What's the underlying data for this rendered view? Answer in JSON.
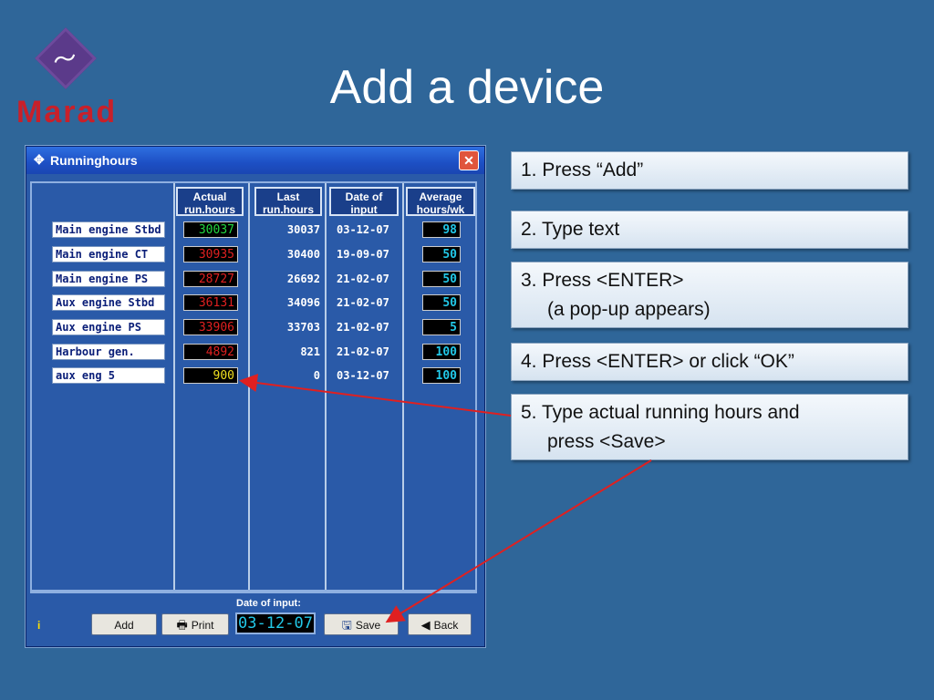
{
  "slide": {
    "title": "Add a device"
  },
  "logo": {
    "text": "Marad"
  },
  "window": {
    "title": "Runninghours",
    "close_label": "✕",
    "columns": {
      "actual": [
        "Actual",
        "run.hours"
      ],
      "last": [
        "Last",
        "run.hours"
      ],
      "date": [
        "Date of",
        "input"
      ],
      "average": [
        "Average",
        "hours/wk"
      ]
    },
    "rows": [
      {
        "name": "Main engine Stbd",
        "actual": "30037",
        "actual_color": "#22d840",
        "last": "30037",
        "date": "03-12-07",
        "avg": "98"
      },
      {
        "name": "Main engine CT",
        "actual": "30935",
        "actual_color": "#e02020",
        "last": "30400",
        "date": "19-09-07",
        "avg": "50"
      },
      {
        "name": "Main engine PS",
        "actual": "28727",
        "actual_color": "#e02020",
        "last": "26692",
        "date": "21-02-07",
        "avg": "50"
      },
      {
        "name": "Aux engine Stbd",
        "actual": "36131",
        "actual_color": "#e02020",
        "last": "34096",
        "date": "21-02-07",
        "avg": "50"
      },
      {
        "name": "Aux engine PS",
        "actual": "33906",
        "actual_color": "#e02020",
        "last": "33703",
        "date": "21-02-07",
        "avg": "5"
      },
      {
        "name": "Harbour gen.",
        "actual": "4892",
        "actual_color": "#e02020",
        "last": "821",
        "date": "21-02-07",
        "avg": "100"
      },
      {
        "name": "aux eng 5",
        "actual": "900",
        "actual_color": "#f0e020",
        "last": "0",
        "date": "03-12-07",
        "avg": "100"
      }
    ],
    "footer": {
      "info": "i",
      "date_of_input_label": "Date of input:",
      "date_of_input_value": "03-12-07",
      "add_label": "Add",
      "print_label": "Print",
      "save_label": "Save",
      "back_label": "Back"
    }
  },
  "steps": [
    {
      "line1": "1. Press “Add”",
      "line2": ""
    },
    {
      "line1": "2. Type text",
      "line2": ""
    },
    {
      "line1": "3. Press <ENTER>",
      "line2": "(a pop-up appears)"
    },
    {
      "line1": "4. Press <ENTER> or click “OK”",
      "line2": ""
    },
    {
      "line1": "5. Type actual running hours and",
      "line2": "press <Save>"
    }
  ],
  "colors": {
    "background": "#2f6699",
    "window": "#2a5aa8",
    "arrow": "#e02020"
  },
  "icons": [
    "marad-logo",
    "app-icon",
    "close-icon",
    "printer-icon",
    "save-icon",
    "back-arrow-icon"
  ]
}
